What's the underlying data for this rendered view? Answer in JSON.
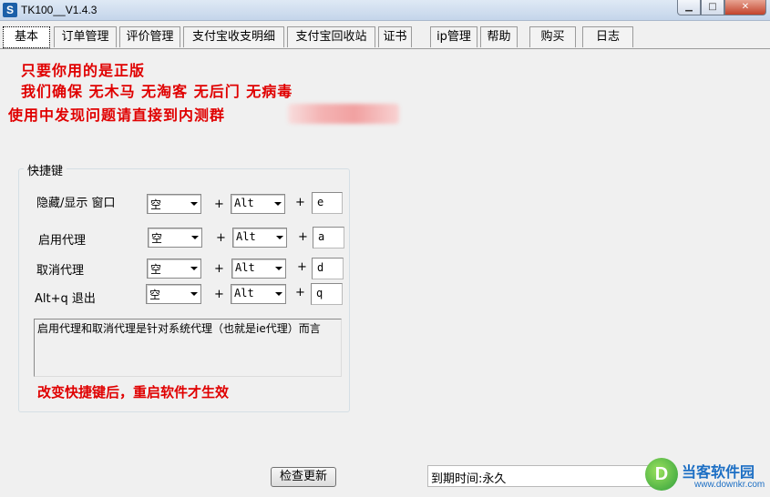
{
  "window": {
    "title": "TK100__V1.4.3",
    "icon": "S",
    "controls": {
      "minimize": "▁",
      "maximize": "□",
      "close": "✕"
    }
  },
  "tabs": [
    {
      "label": "基本",
      "active": true
    },
    {
      "label": "订单管理"
    },
    {
      "label": "评价管理"
    },
    {
      "label": "支付宝收支明细"
    },
    {
      "label": "支付宝回收站"
    },
    {
      "label": "证书"
    },
    {
      "label": "ip管理"
    },
    {
      "label": "帮助"
    },
    {
      "label": "购买"
    },
    {
      "label": "日志"
    }
  ],
  "notices": {
    "line1": "只要你用的是正版",
    "line2": "我们确保  无木马 无淘客 无后门  无病毒",
    "line3": "使用中发现问题请直接到内测群"
  },
  "hotkeys": {
    "group_title": "快捷键",
    "rows": [
      {
        "label": "隐藏/显示 窗口",
        "modifier1": "空",
        "modifier2": "Alt",
        "key": "e"
      },
      {
        "label": "启用代理",
        "modifier1": "空",
        "modifier2": "Alt",
        "key": "a"
      },
      {
        "label": "取消代理",
        "modifier1": "空",
        "modifier2": "Alt",
        "key": "d"
      },
      {
        "label": "Alt+q  退出",
        "modifier1": "空",
        "modifier2": "Alt",
        "key": "q"
      }
    ],
    "plus": "+",
    "description": "启用代理和取消代理是针对系统代理（也就是ie代理）而言",
    "warning": "改变快捷键后，重启软件才生效"
  },
  "footer": {
    "check_update": "检查更新",
    "expiry": "到期时间:永久"
  },
  "watermark": {
    "logo": "D",
    "name": "当客软件园",
    "url": "www.downkr.com"
  },
  "colors": {
    "notice_red": "#e00000",
    "watermark_blue": "#1d6fc4"
  }
}
